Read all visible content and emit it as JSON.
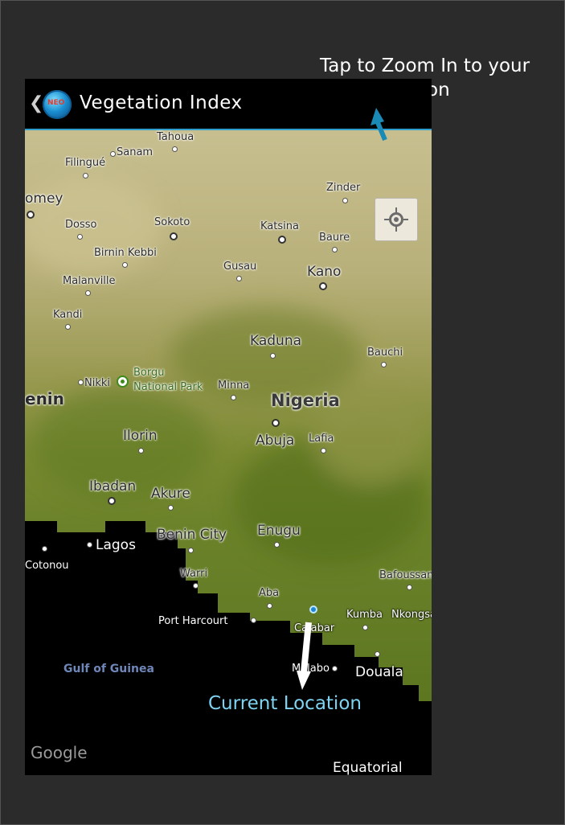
{
  "annotations": {
    "zoom_hint": "Tap to Zoom In to your exact location",
    "current_location": "Current Location"
  },
  "appbar": {
    "back_icon": "chevron-left-icon",
    "logo_text": "NEO",
    "title": "Vegetation Index"
  },
  "map": {
    "locate_button_icon": "crosshair-icon",
    "country": "Nigeria",
    "cities": {
      "tahoua": "Tahoua",
      "sanam": "Sanam",
      "filingue": "Filingué",
      "dahomey": "omey",
      "zinder": "Zinder",
      "dosso": "Dosso",
      "sokoto": "Sokoto",
      "katsina": "Katsina",
      "baure": "Baure",
      "birnin_kebbi": "Birnin Kebbi",
      "gusau": "Gusau",
      "kano": "Kano",
      "malanville": "Malanville",
      "kandi": "Kandi",
      "kaduna": "Kaduna",
      "bauchi": "Bauchi",
      "nikki": "Nikki",
      "benin": "enin",
      "minna": "Minna",
      "ilorin": "Ilorin",
      "abuja": "Abuja",
      "lafia": "Lafia",
      "ibadan": "Ibadan",
      "akure": "Akure",
      "benin_city": "Benin City",
      "enugu": "Enugu",
      "lagos": "Lagos",
      "cotonou": "Cotonou",
      "warri": "Warri",
      "aba": "Aba",
      "port_harcourt": "Port Harcourt",
      "calabar": "Calabar",
      "bafoussam": "Bafoussam",
      "kumba": "Kumba",
      "nkongsamba": "Nkongsa",
      "malabo": "Malabo",
      "douala": "Douala",
      "equatorial": "Equatorial"
    },
    "park": {
      "line1": "Borgu",
      "line2": "National Park"
    },
    "sea": "Gulf of Guinea",
    "attribution": "Google",
    "colors": {
      "arid": "#c9c08e",
      "green": "#5c7d1e",
      "water": "#000000",
      "accent": "#2f9fd0"
    }
  }
}
